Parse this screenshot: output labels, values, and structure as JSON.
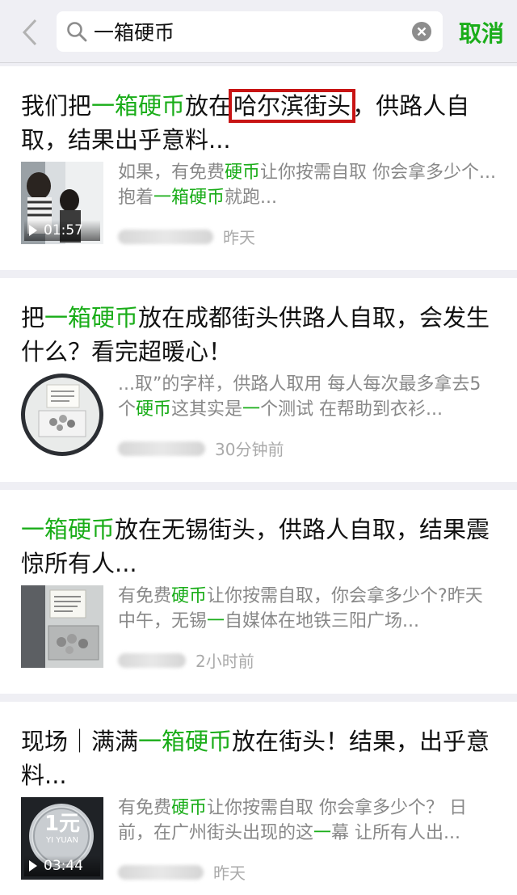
{
  "header": {
    "search_query": "一箱硬币",
    "cancel_label": "取消"
  },
  "colors": {
    "accent_green": "#1aad19",
    "highlight_box": "#c81414",
    "background": "#efeff4"
  },
  "results": [
    {
      "title_parts": [
        {
          "text": "我们把",
          "style": "normal"
        },
        {
          "text": "一箱硬币",
          "style": "highlight"
        },
        {
          "text": "放在",
          "style": "normal"
        },
        {
          "text": "哈尔滨街头",
          "style": "boxed"
        },
        {
          "text": "，供路人自取，结果出乎意料...",
          "style": "normal"
        }
      ],
      "snippet_parts": [
        {
          "text": "如果，有免费",
          "style": "normal"
        },
        {
          "text": "硬币",
          "style": "highlight"
        },
        {
          "text": "让你按需自取 你会拿多少个...抱着",
          "style": "normal"
        },
        {
          "text": "一箱硬币",
          "style": "highlight"
        },
        {
          "text": "就跑...",
          "style": "normal"
        }
      ],
      "video_duration": "01:57",
      "time": "昨天",
      "thumbnail": "video-thumbnail-people"
    },
    {
      "title_parts": [
        {
          "text": "把",
          "style": "normal"
        },
        {
          "text": "一箱硬币",
          "style": "highlight"
        },
        {
          "text": "放在成都街头供路人自取，会发生什么？看完超暖心！",
          "style": "normal"
        }
      ],
      "snippet_parts": [
        {
          "text": "...取”的字样，供路人取用 每人每次最多拿去5个",
          "style": "normal"
        },
        {
          "text": "硬币",
          "style": "highlight"
        },
        {
          "text": "这其实是",
          "style": "normal"
        },
        {
          "text": "一",
          "style": "highlight"
        },
        {
          "text": "个测试 在帮助到衣衫...",
          "style": "normal"
        }
      ],
      "video_duration": "",
      "time": "30分钟前",
      "thumbnail": "coin-box-round-thumbnail"
    },
    {
      "title_parts": [
        {
          "text": "一箱硬币",
          "style": "highlight"
        },
        {
          "text": "放在无锡街头，供路人自取，结果震惊所有人...",
          "style": "normal"
        }
      ],
      "snippet_parts": [
        {
          "text": "有免费",
          "style": "normal"
        },
        {
          "text": "硬币",
          "style": "highlight"
        },
        {
          "text": "让你按需自取，你会拿多少个?昨天中午，无锡",
          "style": "normal"
        },
        {
          "text": "一",
          "style": "highlight"
        },
        {
          "text": "自媒体在地铁三阳广场...",
          "style": "normal"
        }
      ],
      "video_duration": "",
      "time": "2小时前",
      "thumbnail": "coin-box-thumbnail"
    },
    {
      "title_parts": [
        {
          "text": "现场｜满满",
          "style": "normal"
        },
        {
          "text": "一箱硬币",
          "style": "highlight"
        },
        {
          "text": "放在街头！结果，出乎意料...",
          "style": "normal"
        }
      ],
      "snippet_parts": [
        {
          "text": "有免费",
          "style": "normal"
        },
        {
          "text": "硬币",
          "style": "highlight"
        },
        {
          "text": "让你按需自取 你会拿多少个？ 日前，在广州街头出现的这",
          "style": "normal"
        },
        {
          "text": "一",
          "style": "highlight"
        },
        {
          "text": "幕 让所有人出...",
          "style": "normal"
        }
      ],
      "video_duration": "03:44",
      "time": "昨天",
      "thumbnail": "yuan-coin-thumbnail",
      "coin_text": "1元",
      "coin_subtext": "YI YUAN"
    }
  ]
}
